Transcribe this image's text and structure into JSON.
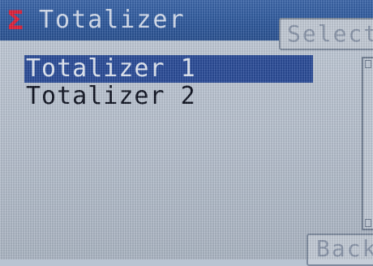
{
  "header": {
    "icon": "sigma-icon",
    "icon_glyph": "Σ",
    "title": "Totalizer",
    "select_label": "Select"
  },
  "list": {
    "items": [
      {
        "label": "Totalizer 1",
        "selected": true
      },
      {
        "label": "Totalizer 2",
        "selected": false
      }
    ]
  },
  "footer": {
    "back_label": "Back"
  },
  "colors": {
    "titlebar": "#2f5a9e",
    "sigma": "#e2223b",
    "selection": "#2b4d9a",
    "background": "#b9c4d2"
  }
}
